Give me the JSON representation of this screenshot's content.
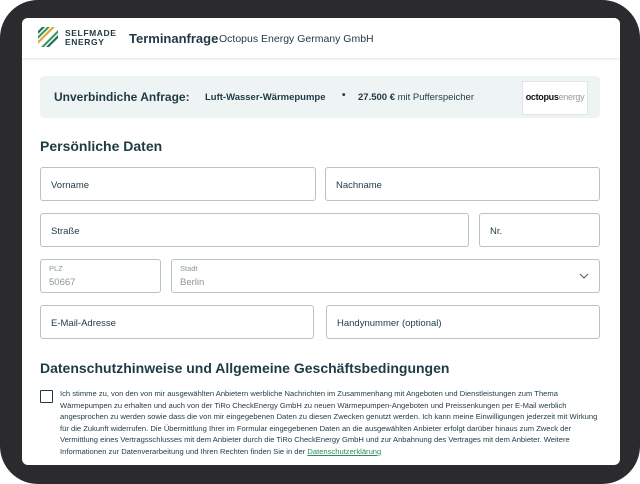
{
  "header": {
    "logo_line1": "SELFMADE",
    "logo_line2": "ENERGY",
    "title": "Terminanfrage",
    "subtitle": "Octopus Energy Germany GmbH"
  },
  "summary": {
    "label": "Unverbindiche Anfrage:",
    "product": "Luft-Wasser-Wärmepumpe",
    "separator": "•",
    "price": "27.500 €",
    "price_suffix": " mit Pufferspeicher",
    "brand_left": "octopus",
    "brand_right": "energy"
  },
  "personal": {
    "heading": "Persönliche Daten",
    "firstname_placeholder": "Vorname",
    "lastname_placeholder": "Nachname",
    "street_placeholder": "Straße",
    "number_placeholder": "Nr.",
    "zip_label": "PLZ",
    "zip_value": "50667",
    "city_label": "Stadt",
    "city_value": "Berlin",
    "email_placeholder": "E-Mail-Adresse",
    "phone_placeholder": "Handynummer (optional)"
  },
  "privacy": {
    "heading": "Datenschutzhinweise und Allgemeine Geschäftsbedingungen",
    "consent_text": "Ich stimme zu, von den von mir ausgewählten Anbietern werbliche Nachrichten im Zusammenhang mit Angeboten und Dienstleistungen zum Thema Wärmepumpen zu erhalten und auch von der TiRo CheckEnergy GmbH zu neuen Wärmepumpen-Angeboten und Preissenkungen per E-Mail werblich angesprochen zu werden sowie dass die von mir eingegebenen Daten zu diesen Zwecken genutzt werden. Ich kann meine Einwilligungen jederzeit mit Wirkung für die Zukunft widerrufen. Die Übermittlung Ihrer im Formular eingegebenen Daten an die ausgewählten Anbieter erfolgt darüber hinaus zum Zweck der Vermittlung eines Vertragsschlusses mit dem Anbieter durch die TiRo CheckEnergy GmbH und zur Anbahnung des Vertrages mit dem Anbieter. Weitere Informationen zur Datenverarbeitung und Ihren Rechten finden Sie in der ",
    "link_text": "Datenschutzerklärung"
  }
}
